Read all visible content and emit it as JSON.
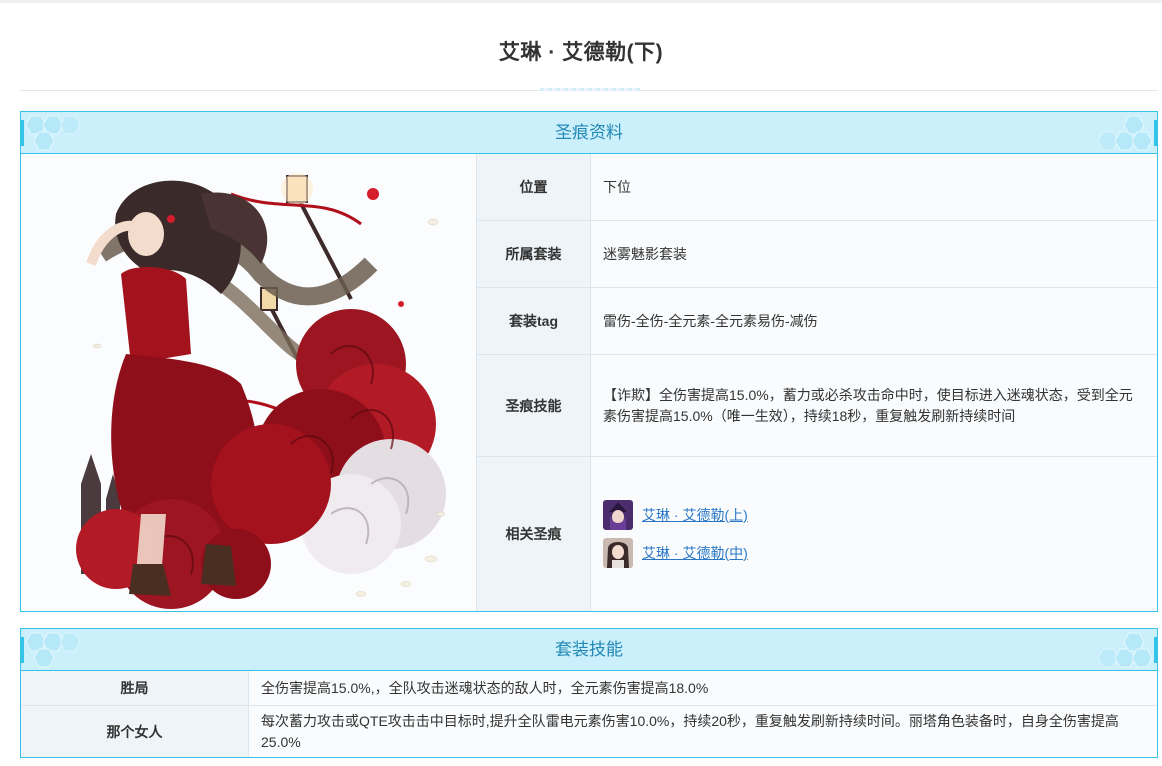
{
  "page": {
    "title": "艾琳 · 艾德勒(下)"
  },
  "info_panel": {
    "header": "圣痕资料",
    "rows": [
      {
        "key": "位置",
        "value": "下位"
      },
      {
        "key": "所属套装",
        "value": "迷雾魅影套装"
      },
      {
        "key": "套装tag",
        "value": "雷伤-全伤-全元素-全元素易伤-减伤"
      },
      {
        "key": "圣痕技能",
        "value": "【诈欺】全伤害提高15.0%，蓄力或必杀攻击命中时，使目标进入迷魂状态，受到全元素伤害提高15.0%（唯一生效），持续18秒，重复触发刷新持续时间"
      },
      {
        "key": "相关圣痕",
        "value": ""
      }
    ],
    "related": [
      {
        "label": "艾琳 · 艾德勒(上)",
        "icon": "character-portrait-icon"
      },
      {
        "label": "艾琳 · 艾德勒(中)",
        "icon": "character-portrait-icon"
      }
    ]
  },
  "set_panel": {
    "header": "套装技能",
    "rows": [
      {
        "key": "胜局",
        "value": "全伤害提高15.0%,，全队攻击迷魂状态的敌人时，全元素伤害提高18.0%"
      },
      {
        "key": "那个女人",
        "value": "每次蓄力攻击或QTE攻击击中目标时,提升全队雷电元素伤害10.0%，持续20秒，重复触发刷新持续时间。丽塔角色装备时，自身全伤害提高25.0%"
      }
    ]
  },
  "colors": {
    "accent": "#35c4e8",
    "header_bg": "#cbf0fb",
    "header_text": "#2288b6",
    "link": "#2a77c6",
    "dress_red": "#a3121d"
  }
}
